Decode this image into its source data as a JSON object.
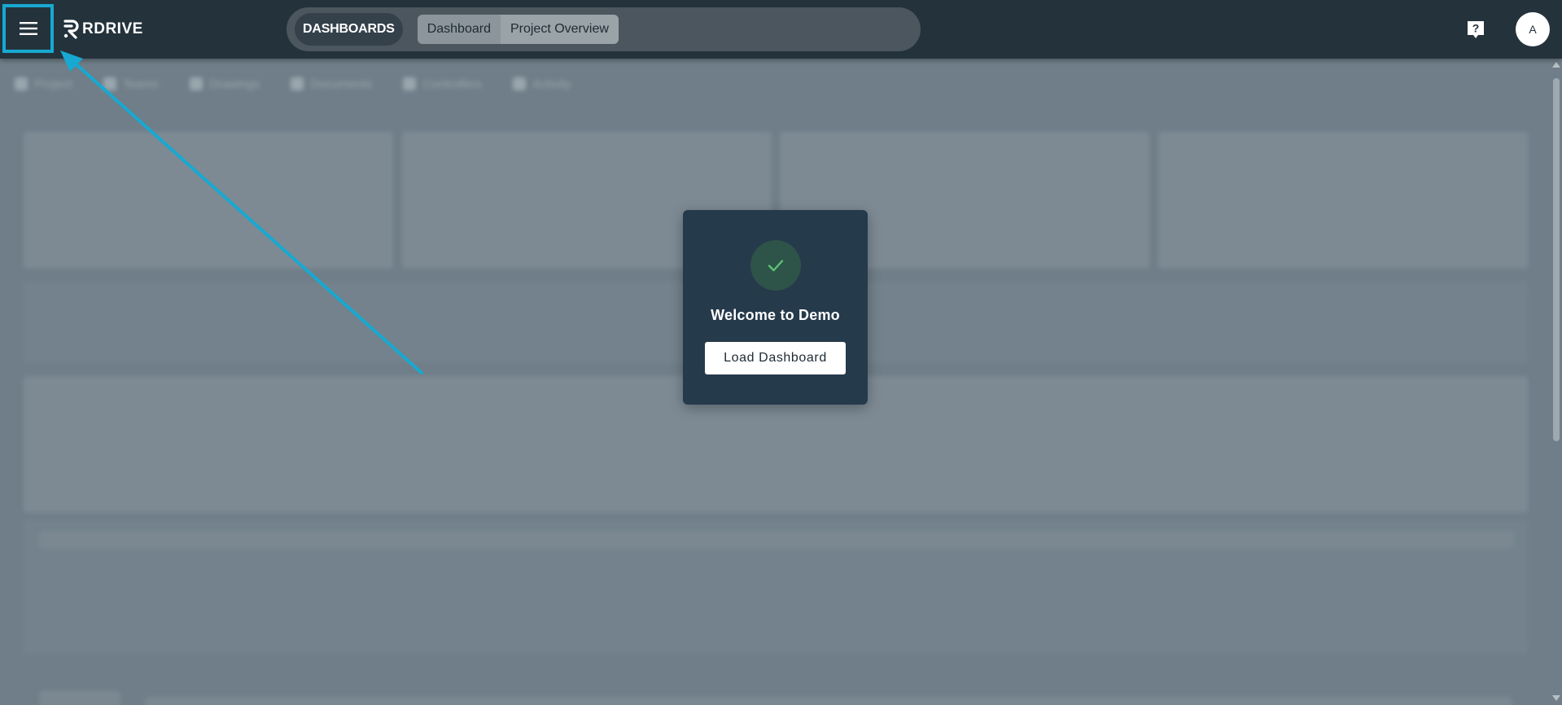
{
  "header": {
    "logo_text": "RDRIVE",
    "section_label": "DASHBOARDS",
    "tabs": [
      {
        "label": "Dashboard"
      },
      {
        "label": "Project Overview"
      }
    ],
    "avatar_initial": "A",
    "icons": {
      "menu": "hamburger-menu-icon",
      "help": "help-question-icon"
    }
  },
  "subnav": {
    "items": [
      {
        "label": "Project"
      },
      {
        "label": "Teams"
      },
      {
        "label": "Drawings"
      },
      {
        "label": "Documents"
      },
      {
        "label": "Controllers"
      },
      {
        "label": "Activity"
      }
    ]
  },
  "modal": {
    "title": "Welcome to Demo",
    "button_label": "Load Dashboard",
    "icon": "check-icon"
  },
  "colors": {
    "topbar": "#24323c",
    "highlight": "#17a9d1",
    "modal_bg": "#253a4b",
    "check": "#5cc274",
    "overlay": "#6f7e88"
  }
}
